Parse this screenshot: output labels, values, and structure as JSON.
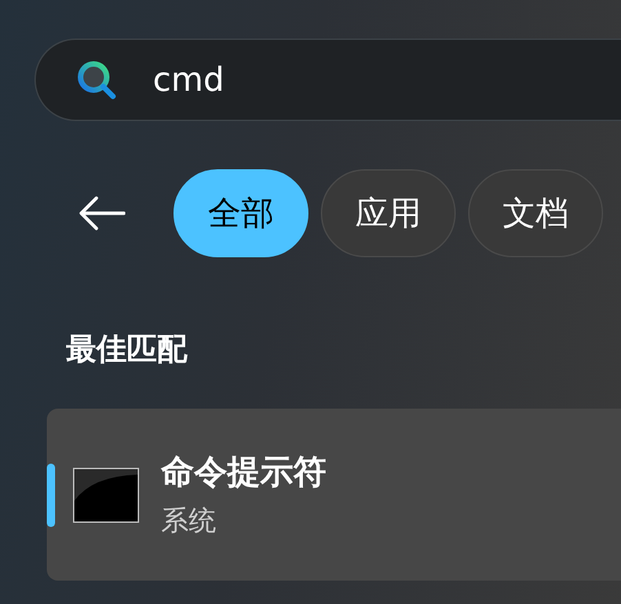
{
  "search": {
    "value": "cmd"
  },
  "filters": [
    {
      "label": "全部",
      "selected": true
    },
    {
      "label": "应用",
      "selected": false
    },
    {
      "label": "文档",
      "selected": false
    }
  ],
  "section_title": "最佳匹配",
  "results": [
    {
      "title": "命令提示符",
      "subtitle": "系统",
      "selected": true
    }
  ]
}
